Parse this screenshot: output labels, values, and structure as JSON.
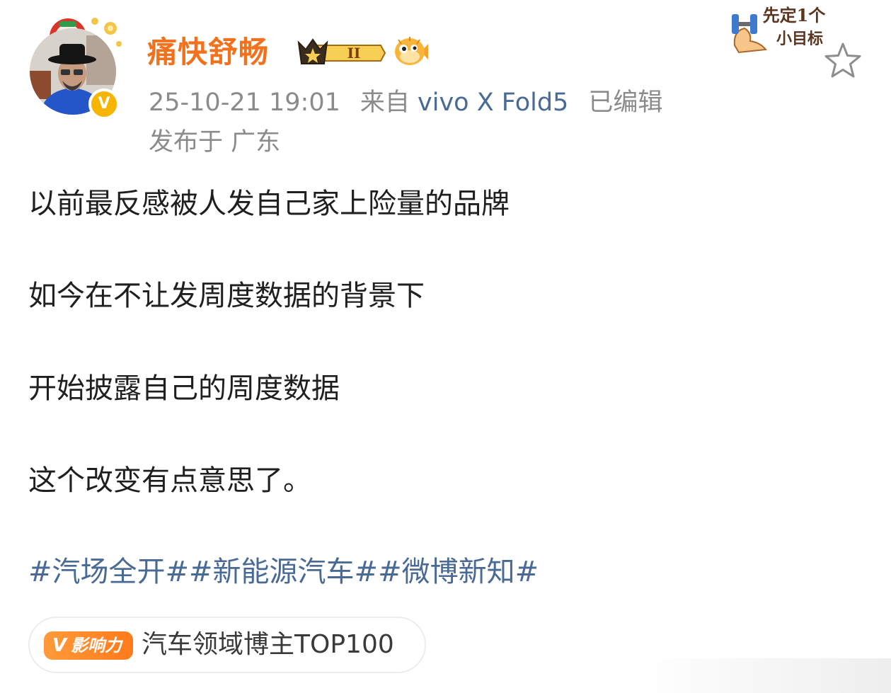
{
  "post": {
    "author": {
      "name": "痛快舒畅",
      "vip_level": "II",
      "verified_mark": "V"
    },
    "meta": {
      "timestamp": "25-10-21 19:01",
      "source_prefix": "来自",
      "device": "vivo X Fold5",
      "edited_label": "已编辑",
      "location": "发布于 广东"
    },
    "sticker": {
      "line1": "先定1个",
      "line2": "小目标"
    },
    "body": [
      "以前最反感被人发自己家上险量的品牌",
      "如今在不让发周度数据的背景下",
      "开始披露自己的周度数据",
      "这个改变有点意思了。"
    ],
    "topics": [
      "#汽场全开#",
      "#新能源汽车#",
      "#微博新知#"
    ],
    "influence": {
      "tag_mark": "V",
      "tag_label": "影响力",
      "text": "汽车领域博主TOP100"
    }
  },
  "colors": {
    "username": "#f2711c",
    "link": "#4a6a96",
    "meta": "#8b8b8b",
    "verified": "#f7b500",
    "influence_tag": "#ff8a2a"
  },
  "icons": {
    "favorite": "star-outline-icon",
    "vip": "crown-vip-badge-icon",
    "fan": "pufferfish-icon",
    "sticker": "dumbbell-arm-icon"
  }
}
